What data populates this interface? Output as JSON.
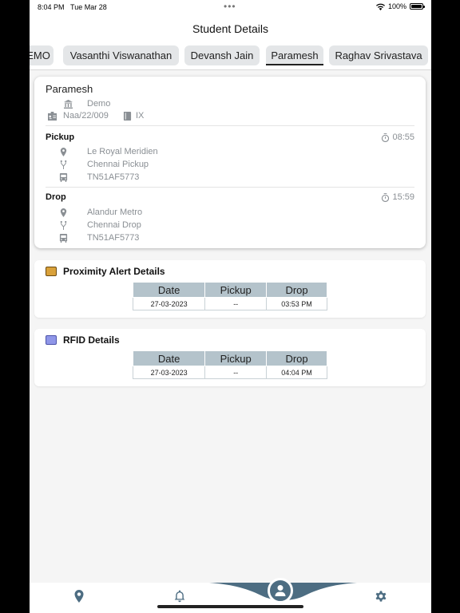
{
  "status": {
    "time": "8:04 PM",
    "date": "Tue Mar 28",
    "battery": "100%"
  },
  "header": {
    "title": "Student Details"
  },
  "tabs": [
    {
      "label": "EMO"
    },
    {
      "label": "Vasanthi Viswanathan"
    },
    {
      "label": "Devansh Jain"
    },
    {
      "label": "Paramesh"
    },
    {
      "label": "Raghav Srivastava"
    }
  ],
  "student": {
    "name": "Paramesh",
    "school": "Demo",
    "id": "Naa/22/009",
    "class": "IX",
    "pickup": {
      "label": "Pickup",
      "time": "08:55",
      "location": "Le Royal Meridien",
      "route": "Chennai Pickup",
      "vehicle": "TN51AF5773"
    },
    "drop": {
      "label": "Drop",
      "time": "15:59",
      "location": "Alandur Metro",
      "route": "Chennai Drop",
      "vehicle": "TN51AF5773"
    }
  },
  "proximity": {
    "title": "Proximity Alert Details",
    "headers": [
      "Date",
      "Pickup",
      "Drop"
    ],
    "row": [
      "27-03-2023",
      "--",
      "03:53 PM"
    ]
  },
  "rfid": {
    "title": "RFID Details",
    "headers": [
      "Date",
      "Pickup",
      "Drop"
    ],
    "row": [
      "27-03-2023",
      "--",
      "04:04 PM"
    ]
  },
  "nav": {
    "items": [
      "location-icon",
      "bell-icon",
      "user-icon",
      "gear-icon"
    ],
    "accent": "#4d6d82"
  }
}
